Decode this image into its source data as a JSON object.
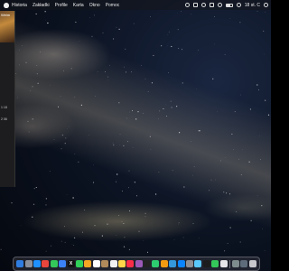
{
  "menubar": {
    "items": [
      "Historia",
      "Zakładki",
      "Profile",
      "Karta",
      "Okno",
      "Pomoc"
    ],
    "clock": "18 st. C"
  },
  "side_window": {
    "title": "Weim",
    "lines": [
      "1 18",
      "2 06"
    ]
  },
  "dock": {
    "icons": [
      {
        "name": "finder-icon",
        "color": "#2f7de1"
      },
      {
        "name": "launchpad-icon",
        "color": "#8a8f99"
      },
      {
        "name": "safari-icon",
        "color": "#1e90ff"
      },
      {
        "name": "chrome-icon",
        "color": "#e8453c"
      },
      {
        "name": "messages-icon",
        "color": "#34c759"
      },
      {
        "name": "mail-icon",
        "color": "#3b82f6"
      },
      {
        "name": "x-icon",
        "color": "#111111"
      },
      {
        "name": "facetime-icon",
        "color": "#30d158"
      },
      {
        "name": "photos-icon",
        "color": "#f5a623"
      },
      {
        "name": "calendar-icon",
        "color": "#ffffff"
      },
      {
        "name": "contacts-icon",
        "color": "#b08a5a"
      },
      {
        "name": "reminders-icon",
        "color": "#f2f2f2"
      },
      {
        "name": "notes-icon",
        "color": "#ffd54a"
      },
      {
        "name": "music-icon",
        "color": "#fa2d48"
      },
      {
        "name": "podcasts-icon",
        "color": "#9b59b6"
      },
      {
        "name": "tv-icon",
        "color": "#222222"
      },
      {
        "name": "numbers-icon",
        "color": "#2ecc71"
      },
      {
        "name": "pages-icon",
        "color": "#f39c12"
      },
      {
        "name": "keynote-icon",
        "color": "#3498db"
      },
      {
        "name": "appstore-icon",
        "color": "#0a84ff"
      },
      {
        "name": "settings-icon",
        "color": "#8e8e93"
      },
      {
        "name": "preview-icon",
        "color": "#5ac8fa"
      },
      {
        "name": "terminal-icon",
        "color": "#1c1c1e"
      },
      {
        "name": "activity-icon",
        "color": "#34c759"
      },
      {
        "name": "textedit-icon",
        "color": "#e5e5ea"
      },
      {
        "name": "finder-window-icon",
        "color": "#7f8c8d"
      },
      {
        "name": "downloads-icon",
        "color": "#5e6b7a"
      },
      {
        "name": "trash-icon",
        "color": "#c7c7cc"
      }
    ],
    "x_label": "X"
  }
}
